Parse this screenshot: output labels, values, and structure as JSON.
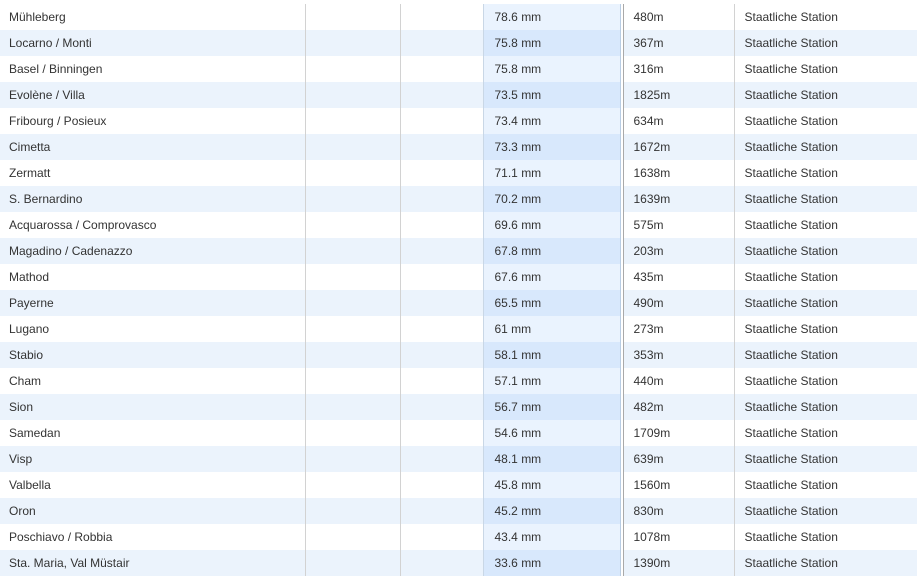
{
  "table": {
    "rows": [
      {
        "station": "Mühleberg",
        "rainfall": "78.6 mm",
        "altitude": "480m",
        "type": "Staatliche Station"
      },
      {
        "station": "Locarno / Monti",
        "rainfall": "75.8 mm",
        "altitude": "367m",
        "type": "Staatliche Station"
      },
      {
        "station": "Basel / Binningen",
        "rainfall": "75.8 mm",
        "altitude": "316m",
        "type": "Staatliche Station"
      },
      {
        "station": "Evolène / Villa",
        "rainfall": "73.5 mm",
        "altitude": "1825m",
        "type": "Staatliche Station"
      },
      {
        "station": "Fribourg / Posieux",
        "rainfall": "73.4 mm",
        "altitude": "634m",
        "type": "Staatliche Station"
      },
      {
        "station": "Cimetta",
        "rainfall": "73.3 mm",
        "altitude": "1672m",
        "type": "Staatliche Station"
      },
      {
        "station": "Zermatt",
        "rainfall": "71.1 mm",
        "altitude": "1638m",
        "type": "Staatliche Station"
      },
      {
        "station": "S. Bernardino",
        "rainfall": "70.2 mm",
        "altitude": "1639m",
        "type": "Staatliche Station"
      },
      {
        "station": "Acquarossa / Comprovasco",
        "rainfall": "69.6 mm",
        "altitude": "575m",
        "type": "Staatliche Station"
      },
      {
        "station": "Magadino / Cadenazzo",
        "rainfall": "67.8 mm",
        "altitude": "203m",
        "type": "Staatliche Station"
      },
      {
        "station": "Mathod",
        "rainfall": "67.6 mm",
        "altitude": "435m",
        "type": "Staatliche Station"
      },
      {
        "station": "Payerne",
        "rainfall": "65.5 mm",
        "altitude": "490m",
        "type": "Staatliche Station"
      },
      {
        "station": "Lugano",
        "rainfall": "61 mm",
        "altitude": "273m",
        "type": "Staatliche Station"
      },
      {
        "station": "Stabio",
        "rainfall": "58.1 mm",
        "altitude": "353m",
        "type": "Staatliche Station"
      },
      {
        "station": "Cham",
        "rainfall": "57.1 mm",
        "altitude": "440m",
        "type": "Staatliche Station"
      },
      {
        "station": "Sion",
        "rainfall": "56.7 mm",
        "altitude": "482m",
        "type": "Staatliche Station"
      },
      {
        "station": "Samedan",
        "rainfall": "54.6 mm",
        "altitude": "1709m",
        "type": "Staatliche Station"
      },
      {
        "station": "Visp",
        "rainfall": "48.1 mm",
        "altitude": "639m",
        "type": "Staatliche Station"
      },
      {
        "station": "Valbella",
        "rainfall": "45.8 mm",
        "altitude": "1560m",
        "type": "Staatliche Station"
      },
      {
        "station": "Oron",
        "rainfall": "45.2 mm",
        "altitude": "830m",
        "type": "Staatliche Station"
      },
      {
        "station": "Poschiavo / Robbia",
        "rainfall": "43.4 mm",
        "altitude": "1078m",
        "type": "Staatliche Station"
      },
      {
        "station": "Sta. Maria, Val Müstair",
        "rainfall": "33.6 mm",
        "altitude": "1390m",
        "type": "Staatliche Station"
      }
    ]
  },
  "colors": {
    "row_odd": "#ffffff",
    "row_even": "#ebf3fc",
    "highlight_column_odd": "#eaf3fe",
    "highlight_column_even": "#d8e8fc",
    "text": "#333333",
    "border": "#d2d2d2"
  }
}
